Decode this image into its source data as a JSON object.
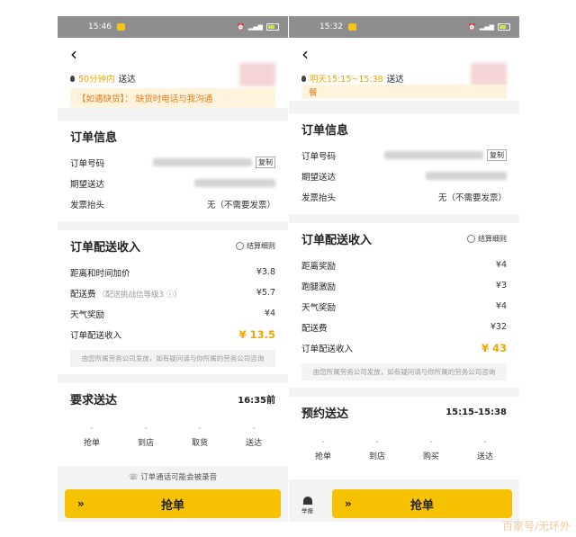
{
  "left": {
    "status": {
      "time": "15:46"
    },
    "deliver_time": "50分钟内",
    "deliver_suffix": "送达",
    "notice": "【如遇缺货】：  缺货时电话与我沟通",
    "order_info": {
      "title": "订单信息",
      "rows": [
        {
          "label": "订单号码",
          "copy": "复制"
        },
        {
          "label": "期望送达"
        },
        {
          "label": "发票抬头",
          "value": "无（不需要发票）"
        }
      ]
    },
    "income": {
      "title": "订单配送收入",
      "detail": "结算细则",
      "rows": [
        {
          "label": "距离和时间加价",
          "value": "¥3.8"
        },
        {
          "label": "配送费",
          "sub": "（配送挑战信等级3 ⓘ）",
          "value": "¥5.7"
        },
        {
          "label": "天气奖励",
          "value": "¥4"
        }
      ],
      "total_label": "订单配送收入",
      "total": "¥ 13.5",
      "note": "由您所属劳务公司发放，如有疑问请与你所属的劳务公司咨询"
    },
    "require": {
      "title": "要求送达",
      "time": "16:35前"
    },
    "steps": [
      "抢单",
      "到店",
      "取货",
      "送达"
    ],
    "record_note": "订单通话可能会被录音",
    "grab_label": "抢单"
  },
  "right": {
    "status": {
      "time": "15:32"
    },
    "deliver_prefix": "明天15:15~15:38",
    "deliver_suffix": "送达",
    "notice": "餐",
    "order_info": {
      "title": "订单信息",
      "rows": [
        {
          "label": "订单号码",
          "copy": "复制"
        },
        {
          "label": "期望送达"
        },
        {
          "label": "发票抬头",
          "value": "无（不需要发票）"
        }
      ]
    },
    "income": {
      "title": "订单配送收入",
      "detail": "结算细则",
      "rows": [
        {
          "label": "距离奖励",
          "value": "¥4"
        },
        {
          "label": "跑腿激励",
          "value": "¥3"
        },
        {
          "label": "天气奖励",
          "value": "¥4"
        },
        {
          "label": "配送费",
          "value": "¥32"
        }
      ],
      "total_label": "订单配送收入",
      "total": "¥ 43",
      "note": "由您所属劳务公司发放，如有疑问请与你所属的劳务公司咨询"
    },
    "require": {
      "title": "预约送达",
      "time": "15:15-15:38"
    },
    "steps": [
      "抢单",
      "到店",
      "购买",
      "送达"
    ],
    "bell_label": "举报",
    "grab_label": "抢单"
  },
  "watermark": "百家号/无环外"
}
